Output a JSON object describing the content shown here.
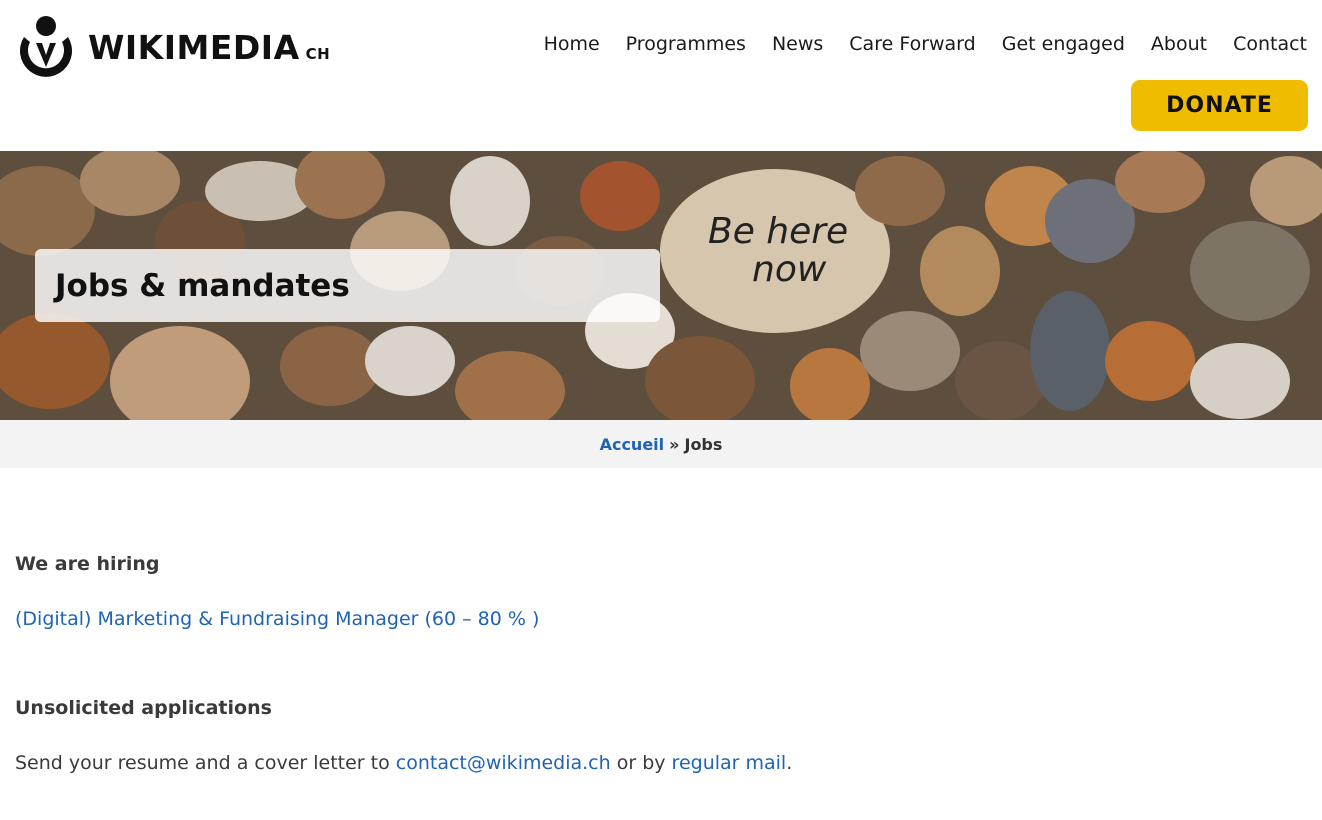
{
  "header": {
    "logo_text": "WIKIMEDIA",
    "logo_sub": "CH",
    "nav": [
      "Home",
      "Programmes",
      "News",
      "Care Forward",
      "Get engaged",
      "About",
      "Contact"
    ],
    "donate_label": "DONATE"
  },
  "hero": {
    "title": "Jobs & mandates",
    "stone_text_line1": "Be here",
    "stone_text_line2": "now"
  },
  "breadcrumb": {
    "home": "Accueil",
    "separator": "»",
    "current": "Jobs"
  },
  "content": {
    "hiring_heading": "We are hiring",
    "job_link": "(Digital) Marketing & Fundraising Manager (60 – 80 % )",
    "unsolicited_heading": "Unsolicited applications",
    "send_prefix": "Send your resume and a cover letter to ",
    "email_link": "contact@wikimedia.ch",
    "send_middle": " or by ",
    "mail_link": "regular mail",
    "send_suffix": "."
  },
  "colors": {
    "donate_bg": "#f0bc00",
    "link": "#1e63b5",
    "breadcrumb_bg": "#f3f3f3"
  }
}
